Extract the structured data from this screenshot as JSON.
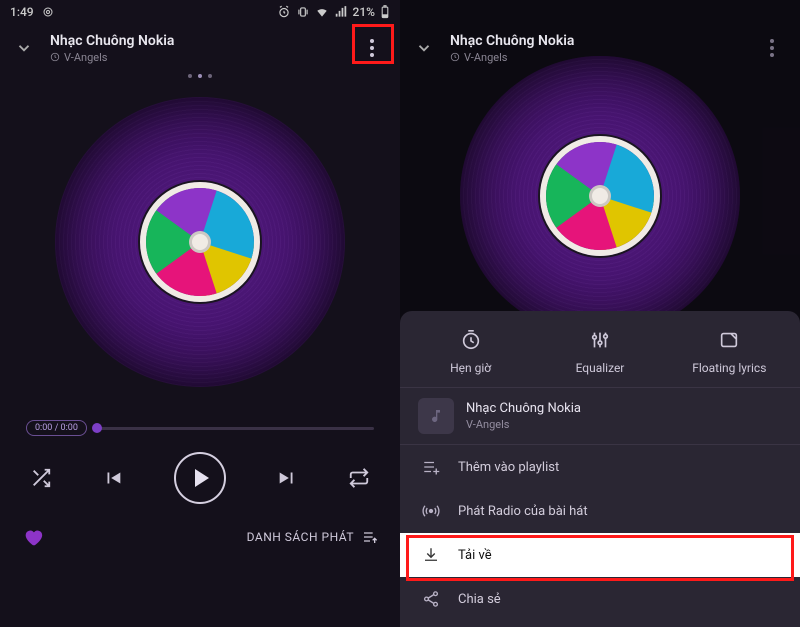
{
  "statusbar": {
    "time": "1:49",
    "battery_percent": "21%"
  },
  "player": {
    "title": "Nhạc Chuông Nokia",
    "artist": "V-Angels",
    "time_pill": "0:00 / 0:00",
    "queue_label": "DANH SÁCH PHÁT"
  },
  "sheet": {
    "timer": "Hẹn giờ",
    "equalizer": "Equalizer",
    "floating_lyrics": "Floating lyrics",
    "song_title": "Nhạc Chuông Nokia",
    "song_artist": "V-Angels",
    "add_playlist": "Thêm vào playlist",
    "play_radio": "Phát Radio của bài hát",
    "download": "Tải về",
    "share": "Chia sẻ"
  }
}
